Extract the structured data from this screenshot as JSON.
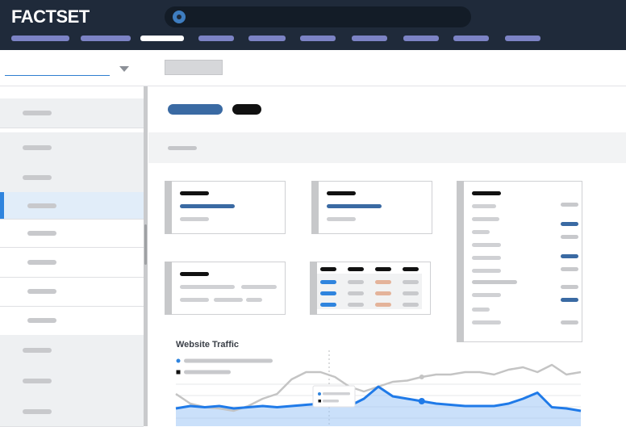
{
  "header": {
    "brand": "FACTSET"
  },
  "colors": {
    "header_bg": "#1f2a3a",
    "nav_tab": "#7c83c5",
    "accent_blue": "#2f84de",
    "button_blue": "#3a6aa3",
    "traffic_line": "#1f7ae8",
    "comparison_line": "#c4c4c4"
  },
  "icons": [
    "search-icon",
    "chevron-down-icon"
  ],
  "chart": {
    "title": "Website Traffic"
  },
  "chart_data": {
    "type": "line",
    "title": "Website Traffic",
    "series": [
      {
        "values": [
          1,
          0.6,
          0.45,
          0.4,
          0.3,
          0.5,
          0.8,
          1.0,
          1.6,
          1.9,
          1.9,
          1.7,
          1.3,
          1.1,
          1.3,
          1.5,
          1.55,
          1.7,
          1.8,
          1.8,
          1.9,
          1.9,
          1.8,
          2.0,
          2.1,
          1.9,
          2.2,
          1.8,
          1.9
        ]
      },
      {
        "values": [
          0.4,
          0.5,
          0.45,
          0.5,
          0.4,
          0.45,
          0.5,
          0.45,
          0.5,
          0.55,
          0.6,
          0.55,
          0.5,
          0.8,
          1.3,
          0.9,
          0.8,
          0.7,
          0.6,
          0.55,
          0.5,
          0.5,
          0.5,
          0.6,
          0.8,
          1.05,
          0.45,
          0.4,
          0.3
        ]
      }
    ]
  }
}
